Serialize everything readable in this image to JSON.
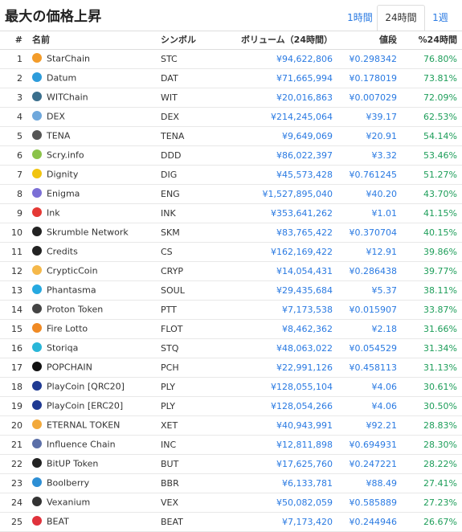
{
  "title": "最大の価格上昇",
  "tabs": [
    {
      "label": "1時間",
      "active": false
    },
    {
      "label": "24時間",
      "active": true
    },
    {
      "label": "1週",
      "active": false
    }
  ],
  "columns": {
    "rank": "#",
    "name": "名前",
    "symbol": "シンボル",
    "volume": "ボリューム（24時間）",
    "price": "値段",
    "change": "%24時間"
  },
  "colors": {
    "link": "#2a7ae2",
    "positive": "#1e9e5a"
  },
  "rows": [
    {
      "rank": "1",
      "name": "StarChain",
      "symbol": "STC",
      "volume": "¥94,622,806",
      "price": "¥0.298342",
      "change": "76.80%",
      "icon": "starchain-icon",
      "icon_color": "#f39c2a"
    },
    {
      "rank": "2",
      "name": "Datum",
      "symbol": "DAT",
      "volume": "¥71,665,994",
      "price": "¥0.178019",
      "change": "73.81%",
      "icon": "datum-icon",
      "icon_color": "#2d9cdb"
    },
    {
      "rank": "3",
      "name": "WITChain",
      "symbol": "WIT",
      "volume": "¥20,016,863",
      "price": "¥0.007029",
      "change": "72.09%",
      "icon": "witchain-icon",
      "icon_color": "#3a6e8c"
    },
    {
      "rank": "4",
      "name": "DEX",
      "symbol": "DEX",
      "volume": "¥214,245,064",
      "price": "¥39.17",
      "change": "62.53%",
      "icon": "dex-icon",
      "icon_color": "#6fa8dc"
    },
    {
      "rank": "5",
      "name": "TENA",
      "symbol": "TENA",
      "volume": "¥9,649,069",
      "price": "¥20.91",
      "change": "54.14%",
      "icon": "tena-icon",
      "icon_color": "#555555"
    },
    {
      "rank": "6",
      "name": "Scry.info",
      "symbol": "DDD",
      "volume": "¥86,022,397",
      "price": "¥3.32",
      "change": "53.46%",
      "icon": "scry-icon",
      "icon_color": "#8bc34a"
    },
    {
      "rank": "7",
      "name": "Dignity",
      "symbol": "DIG",
      "volume": "¥45,573,428",
      "price": "¥0.761245",
      "change": "51.27%",
      "icon": "dignity-icon",
      "icon_color": "#f1c40f"
    },
    {
      "rank": "8",
      "name": "Enigma",
      "symbol": "ENG",
      "volume": "¥1,527,895,040",
      "price": "¥40.20",
      "change": "43.70%",
      "icon": "enigma-icon",
      "icon_color": "#7b6fd6"
    },
    {
      "rank": "9",
      "name": "Ink",
      "symbol": "INK",
      "volume": "¥353,641,262",
      "price": "¥1.01",
      "change": "41.15%",
      "icon": "ink-icon",
      "icon_color": "#e53935"
    },
    {
      "rank": "10",
      "name": "Skrumble Network",
      "symbol": "SKM",
      "volume": "¥83,765,422",
      "price": "¥0.370704",
      "change": "40.15%",
      "icon": "skrumble-icon",
      "icon_color": "#222222"
    },
    {
      "rank": "11",
      "name": "Credits",
      "symbol": "CS",
      "volume": "¥162,169,422",
      "price": "¥12.91",
      "change": "39.86%",
      "icon": "credits-icon",
      "icon_color": "#222222"
    },
    {
      "rank": "12",
      "name": "CrypticCoin",
      "symbol": "CRYP",
      "volume": "¥14,054,431",
      "price": "¥0.286438",
      "change": "39.77%",
      "icon": "crypticcoin-icon",
      "icon_color": "#f5b84a"
    },
    {
      "rank": "13",
      "name": "Phantasma",
      "symbol": "SOUL",
      "volume": "¥29,435,684",
      "price": "¥5.37",
      "change": "38.11%",
      "icon": "phantasma-icon",
      "icon_color": "#26a9e0"
    },
    {
      "rank": "14",
      "name": "Proton Token",
      "symbol": "PTT",
      "volume": "¥7,173,538",
      "price": "¥0.015907",
      "change": "33.87%",
      "icon": "proton-icon",
      "icon_color": "#444444"
    },
    {
      "rank": "15",
      "name": "Fire Lotto",
      "symbol": "FLOT",
      "volume": "¥8,462,362",
      "price": "¥2.18",
      "change": "31.66%",
      "icon": "firelotto-icon",
      "icon_color": "#f08a24"
    },
    {
      "rank": "16",
      "name": "Storiqa",
      "symbol": "STQ",
      "volume": "¥48,063,022",
      "price": "¥0.054529",
      "change": "31.34%",
      "icon": "storiqa-icon",
      "icon_color": "#29b6d8"
    },
    {
      "rank": "17",
      "name": "POPCHAIN",
      "symbol": "PCH",
      "volume": "¥22,991,126",
      "price": "¥0.458113",
      "change": "31.13%",
      "icon": "popchain-icon",
      "icon_color": "#111111"
    },
    {
      "rank": "18",
      "name": "PlayCoin [QRC20]",
      "symbol": "PLY",
      "volume": "¥128,055,104",
      "price": "¥4.06",
      "change": "30.61%",
      "icon": "playcoin-icon",
      "icon_color": "#1f3a93"
    },
    {
      "rank": "19",
      "name": "PlayCoin [ERC20]",
      "symbol": "PLY",
      "volume": "¥128,054,266",
      "price": "¥4.06",
      "change": "30.50%",
      "icon": "playcoin-icon",
      "icon_color": "#1f3a93"
    },
    {
      "rank": "20",
      "name": "ETERNAL TOKEN",
      "symbol": "XET",
      "volume": "¥40,943,991",
      "price": "¥92.21",
      "change": "28.83%",
      "icon": "eternal-token-icon",
      "icon_color": "#f2a93b"
    },
    {
      "rank": "21",
      "name": "Influence Chain",
      "symbol": "INC",
      "volume": "¥12,811,898",
      "price": "¥0.694931",
      "change": "28.30%",
      "icon": "influence-chain-icon",
      "icon_color": "#5b6fa8"
    },
    {
      "rank": "22",
      "name": "BitUP Token",
      "symbol": "BUT",
      "volume": "¥17,625,760",
      "price": "¥0.247221",
      "change": "28.22%",
      "icon": "bitup-icon",
      "icon_color": "#222222"
    },
    {
      "rank": "23",
      "name": "Boolberry",
      "symbol": "BBR",
      "volume": "¥6,133,781",
      "price": "¥88.49",
      "change": "27.41%",
      "icon": "boolberry-icon",
      "icon_color": "#2d8fd5"
    },
    {
      "rank": "24",
      "name": "Vexanium",
      "symbol": "VEX",
      "volume": "¥50,082,059",
      "price": "¥0.585889",
      "change": "27.23%",
      "icon": "vexanium-icon",
      "icon_color": "#333333"
    },
    {
      "rank": "25",
      "name": "BEAT",
      "symbol": "BEAT",
      "volume": "¥7,173,420",
      "price": "¥0.244946",
      "change": "26.67%",
      "icon": "beat-icon",
      "icon_color": "#e0323c"
    }
  ]
}
